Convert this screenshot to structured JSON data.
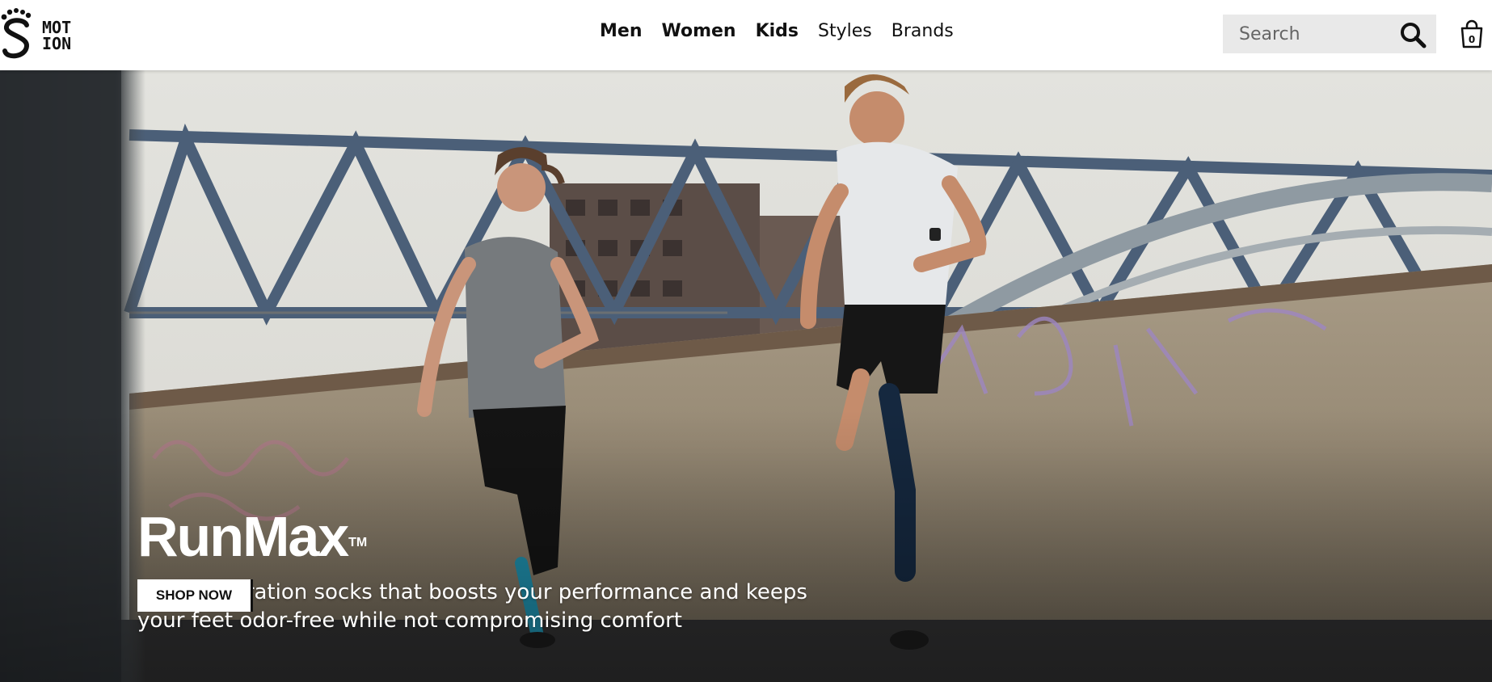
{
  "brand": {
    "logo_line1": "MOT",
    "logo_line2": "ION",
    "logo_icon": "footprint-s-icon"
  },
  "nav": {
    "items": [
      {
        "label": "Men",
        "bold": true
      },
      {
        "label": "Women",
        "bold": true
      },
      {
        "label": "Kids",
        "bold": true
      },
      {
        "label": "Styles",
        "bold": false
      },
      {
        "label": "Brands",
        "bold": false
      }
    ]
  },
  "search": {
    "placeholder": "Search",
    "value": "",
    "icon": "search-icon"
  },
  "cart": {
    "icon": "shopping-bag-icon",
    "count": "0"
  },
  "hero": {
    "title": "RunMax",
    "trademark": "TM",
    "subtitle": "Next generation socks that boosts your performance and keeps your feet odor-free while not compromising comfort",
    "cta_label": "SHOP NOW"
  },
  "colors": {
    "header_bg": "#ffffff",
    "search_bg": "#e9e9e9",
    "text": "#111111",
    "hero_text": "#ffffff"
  }
}
